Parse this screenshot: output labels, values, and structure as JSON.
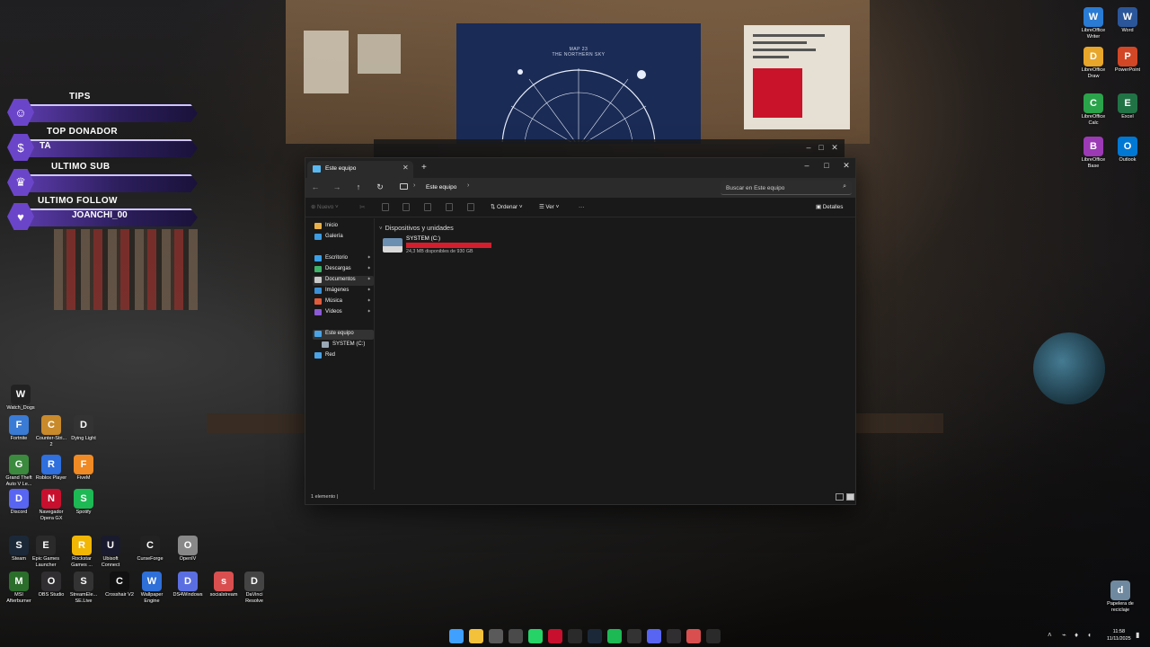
{
  "overlay": {
    "tips": {
      "title": "TIPS",
      "value": ""
    },
    "top_donador": {
      "title": "TOP DONADOR",
      "value": "TA"
    },
    "ultimo_sub": {
      "title": "ULTIMO SUB",
      "value": ""
    },
    "ultimo_follow": {
      "title": "ULTIMO FOLLOW",
      "value": "JOANCHI_00"
    }
  },
  "wallpaper": {
    "poster_title": "MAP 23",
    "poster_subtitle": "THE NORTHERN SKY"
  },
  "desktop_left": [
    {
      "label": "Watch_Dogs",
      "icon": "watch-dogs-icon",
      "color": "#222222"
    },
    {
      "label": "Fortnite",
      "icon": "fortnite-icon",
      "color": "#3a7bd5"
    },
    {
      "label": "Counter-Stri... 2",
      "icon": "counter-strike-icon",
      "color": "#c98a2b"
    },
    {
      "label": "Dying Light",
      "icon": "dying-light-icon",
      "color": "#333333"
    },
    {
      "label": "Grand Theft Auto V Le...",
      "icon": "gta-icon",
      "color": "#3b8a3e"
    },
    {
      "label": "Roblox Player",
      "icon": "roblox-icon",
      "color": "#2f6fde"
    },
    {
      "label": "FiveM",
      "icon": "fivem-icon",
      "color": "#f08a24"
    },
    {
      "label": "Discord",
      "icon": "discord-icon",
      "color": "#5865f2"
    },
    {
      "label": "Navegador Opera GX",
      "icon": "opera-gx-icon",
      "color": "#c8102e"
    },
    {
      "label": "Spotify",
      "icon": "spotify-icon",
      "color": "#1db954"
    },
    {
      "label": "Steam",
      "icon": "steam-icon",
      "color": "#1b2838"
    },
    {
      "label": "Epic Games Launcher",
      "icon": "epic-games-icon",
      "color": "#2a2a2a"
    },
    {
      "label": "Rockstar Games ...",
      "icon": "rockstar-icon",
      "color": "#f2b705"
    },
    {
      "label": "Ubisoft Connect",
      "icon": "ubisoft-icon",
      "color": "#1a1a2e"
    },
    {
      "label": "CurseForge",
      "icon": "curseforge-icon",
      "color": "#222222"
    },
    {
      "label": "OpenIV",
      "icon": "openiv-icon",
      "color": "#888888"
    },
    {
      "label": "MSI Afterburner",
      "icon": "msi-afterburner-icon",
      "color": "#2b6e2b"
    },
    {
      "label": "OBS Studio",
      "icon": "obs-icon",
      "color": "#302e31"
    },
    {
      "label": "StreamEle... SE.Live",
      "icon": "streamelements-icon",
      "color": "#333333"
    },
    {
      "label": "Crosshair V2",
      "icon": "crosshair-icon",
      "color": "#111111"
    },
    {
      "label": "Wallpaper Engine",
      "icon": "wallpaper-engine-icon",
      "color": "#2e6fd8"
    },
    {
      "label": "DS4Windows",
      "icon": "ds4windows-icon",
      "color": "#5b6ee1"
    },
    {
      "label": "socialstream",
      "icon": "socialstream-icon",
      "color": "#d94f4f"
    },
    {
      "label": "DaVinci Resolve",
      "icon": "davinci-icon",
      "color": "#444444"
    }
  ],
  "desktop_right": [
    {
      "label": "LibreOffice Writer",
      "icon": "libreoffice-writer-icon",
      "color": "#2a7bd3"
    },
    {
      "label": "Word",
      "icon": "word-icon",
      "color": "#2b579a"
    },
    {
      "label": "LibreOffice Draw",
      "icon": "libreoffice-draw-icon",
      "color": "#e8a62a"
    },
    {
      "label": "PowerPoint",
      "icon": "powerpoint-icon",
      "color": "#d24726"
    },
    {
      "label": "LibreOffice Calc",
      "icon": "libreoffice-calc-icon",
      "color": "#2aa34a"
    },
    {
      "label": "Excel",
      "icon": "excel-icon",
      "color": "#217346"
    },
    {
      "label": "LibreOffice Base",
      "icon": "libreoffice-base-icon",
      "color": "#9c3ab5"
    },
    {
      "label": "Outlook",
      "icon": "outlook-icon",
      "color": "#0078d4"
    },
    {
      "label": "Papelera de reciclaje",
      "icon": "recycle-bin-icon",
      "color": "#6f8aa0"
    }
  ],
  "explorer": {
    "tab_title": "Este equipo",
    "breadcrumb": "Este equipo",
    "search_placeholder": "Buscar en Este equipo",
    "toolbar": {
      "nuevo": "Nuevo",
      "ordenar": "Ordenar",
      "ver": "Ver",
      "more": "···",
      "detalles": "Detalles"
    },
    "sidebar": [
      {
        "label": "Inicio",
        "icon": "home-icon",
        "color": "#e8b04a",
        "pinned": false
      },
      {
        "label": "Galería",
        "icon": "gallery-icon",
        "color": "#3d9be0",
        "pinned": false
      },
      {
        "label": "Escritorio",
        "icon": "desktop-icon",
        "color": "#3aa0e8",
        "pinned": true
      },
      {
        "label": "Descargas",
        "icon": "download-icon",
        "color": "#3fb36a",
        "pinned": true
      },
      {
        "label": "Documentos",
        "icon": "documents-icon",
        "color": "#c9c9c9",
        "pinned": true
      },
      {
        "label": "Imágenes",
        "icon": "pictures-icon",
        "color": "#3b8fd6",
        "pinned": true
      },
      {
        "label": "Música",
        "icon": "music-icon",
        "color": "#e25b3a",
        "pinned": true
      },
      {
        "label": "Vídeos",
        "icon": "videos-icon",
        "color": "#8b5ad6",
        "pinned": true
      },
      {
        "label": "Este equipo",
        "icon": "this-pc-icon",
        "color": "#4aa3e6",
        "pinned": false
      },
      {
        "label": "SYSTEM (C:)",
        "icon": "drive-icon",
        "color": "#9aa8b5",
        "pinned": false
      },
      {
        "label": "Red",
        "icon": "network-icon",
        "color": "#4aa3e6",
        "pinned": false
      }
    ],
    "group_title": "Dispositivos y unidades",
    "drive": {
      "name": "SYSTEM (C:)",
      "free_text": "24,3 MB disponibles de 930 GB",
      "used_fraction": 0.99997,
      "bar_color": "#d41e2d"
    },
    "status": "1 elemento  |"
  },
  "taskbar": {
    "apps": [
      {
        "icon": "start-icon",
        "color": "#3fa0ff"
      },
      {
        "icon": "file-explorer-icon",
        "color": "#f3c13a"
      },
      {
        "icon": "screen-capture-icon",
        "color": "#5a5a5a"
      },
      {
        "icon": "chrome-icon",
        "color": "#4a4a4a"
      },
      {
        "icon": "whatsapp-icon",
        "color": "#25d366"
      },
      {
        "icon": "opera-gx-icon",
        "color": "#c8102e"
      },
      {
        "icon": "epic-games-icon",
        "color": "#2a2a2a"
      },
      {
        "icon": "steam-icon",
        "color": "#1b2838"
      },
      {
        "icon": "spotify-icon",
        "color": "#1db954"
      },
      {
        "icon": "terminal-icon",
        "color": "#333333"
      },
      {
        "icon": "discord-icon",
        "color": "#5865f2"
      },
      {
        "icon": "obs-icon",
        "color": "#302e31"
      },
      {
        "icon": "socialstream-icon",
        "color": "#d94f4f"
      },
      {
        "icon": "epic-icon",
        "color": "#2a2a2a"
      }
    ],
    "time": "11:58",
    "date": "11/11/2025"
  }
}
